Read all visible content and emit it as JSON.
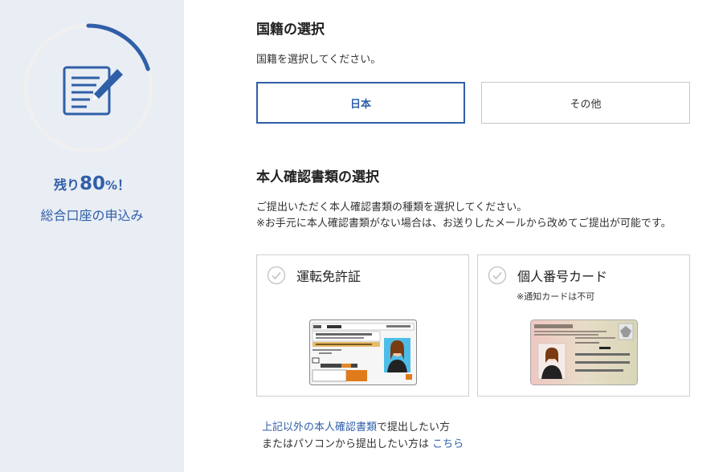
{
  "sidebar": {
    "progress": 0.8,
    "remaining_label": "残り",
    "remaining_percent": "80",
    "percent_sign": "%",
    "exclaim": "！",
    "application_title": "総合口座の申込み"
  },
  "nationality": {
    "title": "国籍の選択",
    "instruction": "国籍を選択してください。",
    "options": [
      "日本",
      "その他"
    ],
    "selected": "日本"
  },
  "id_docs": {
    "title": "本人確認書類の選択",
    "instruction_line1": "ご提出いただく本人確認書類の種類を選択してください。",
    "instruction_line2": "※お手元に本人確認書類がない場合は、お送りしたメールから改めてご提出が可能です。",
    "cards": [
      {
        "title": "運転免許証",
        "note": ""
      },
      {
        "title": "個人番号カード",
        "note": "※通知カードは不可"
      }
    ]
  },
  "footer": {
    "link1": "上記以外の本人確認書類",
    "text1": "で提出したい方",
    "text2": "またはパソコンから提出したい方は",
    "link2": "こちら"
  },
  "colors": {
    "accent": "#2f5fa8",
    "sidebar_bg": "#e9edf4",
    "ring_bg": "#f0f0f0"
  }
}
